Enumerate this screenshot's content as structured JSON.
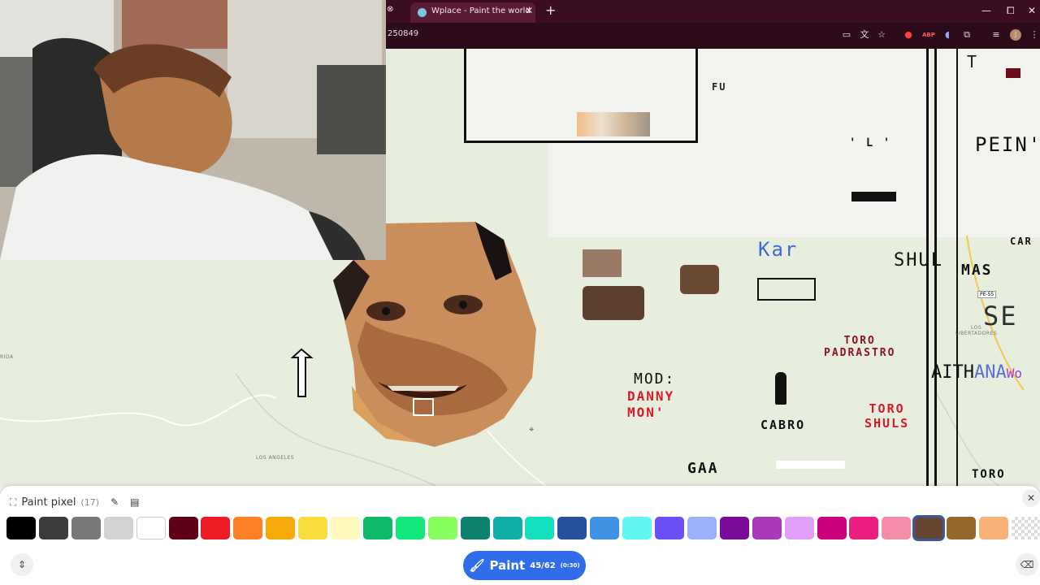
{
  "browser": {
    "prev_tab_close": "⊗",
    "tab_title": "Wplace - Paint the world",
    "tab_close": "✕",
    "new_tab": "+",
    "url_fragment": "250849",
    "win_min": "—",
    "win_max": "⧠",
    "win_close": "✕"
  },
  "map": {
    "texts": {
      "fu": "FU",
      "l": "' L '",
      "pein": "PEIN'",
      "t": "L T",
      "kar": "Kar",
      "shuls_top": "SHUL",
      "mas": "MAS",
      "car": "CAR",
      "se": "SE",
      "toro_padrastro": "TORO\nPADRASTRO",
      "mod": "MOD:",
      "danny": "DANNY\nMON'",
      "cabro": "CABRO",
      "toro_shuls": "TORO\nSHULS",
      "aith": "AITH",
      "ana": "ANA",
      "gaa": "GAA",
      "toro_bottom": "TORO",
      "pe55": "PE-55"
    },
    "labels": {
      "rida": "RIDA",
      "los_angeles": "LOS ANGELES",
      "los_libertadores": "LOS\nLIBERTADORES"
    }
  },
  "panel": {
    "title": "Paint pixel",
    "count": "(17)",
    "colors": [
      "#000000",
      "#3c3c3c",
      "#787878",
      "#d2d2d2",
      "#ffffff",
      "#600018",
      "#ed1c24",
      "#ff7f27",
      "#f6aa09",
      "#f9dd3b",
      "#fffabc",
      "#0eb968",
      "#13e67b",
      "#87ff5e",
      "#0c816e",
      "#10aea6",
      "#13e1be",
      "#28509e",
      "#4093e4",
      "#60f7f2",
      "#6b50f6",
      "#99b1fb",
      "#780c99",
      "#aa38b9",
      "#e09ff9",
      "#cb007a",
      "#ec1f80",
      "#f38da9",
      "#684634",
      "#95682a",
      "#f8b277"
    ],
    "selected_index": 28,
    "paint_label": "Paint",
    "paint_count": "45/62",
    "paint_timer": "(0:30)"
  }
}
